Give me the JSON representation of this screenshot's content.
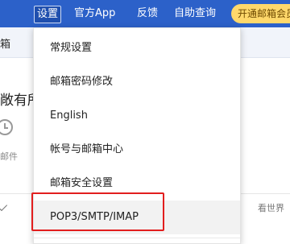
{
  "topbar": {
    "settings_label": "设置",
    "official_app_label": "官方App",
    "feedback_label": "反馈",
    "self_help_label": "自助查询",
    "vip_label": "开通邮箱会员"
  },
  "subbar": {
    "text": "箱"
  },
  "background": {
    "heading": "敞有所",
    "mail_label": "邮件",
    "world_label": "看世界"
  },
  "menu": {
    "items": [
      {
        "label": "常规设置"
      },
      {
        "label": "邮箱密码修改"
      },
      {
        "label": "English"
      },
      {
        "label": "帐号与邮箱中心"
      },
      {
        "label": "邮箱安全设置"
      },
      {
        "label": "POP3/SMTP/IMAP"
      }
    ]
  },
  "colors": {
    "nav_bg": "#2c61c9",
    "vip_bg": "#ffd86b",
    "highlight": "#e21e1e"
  }
}
